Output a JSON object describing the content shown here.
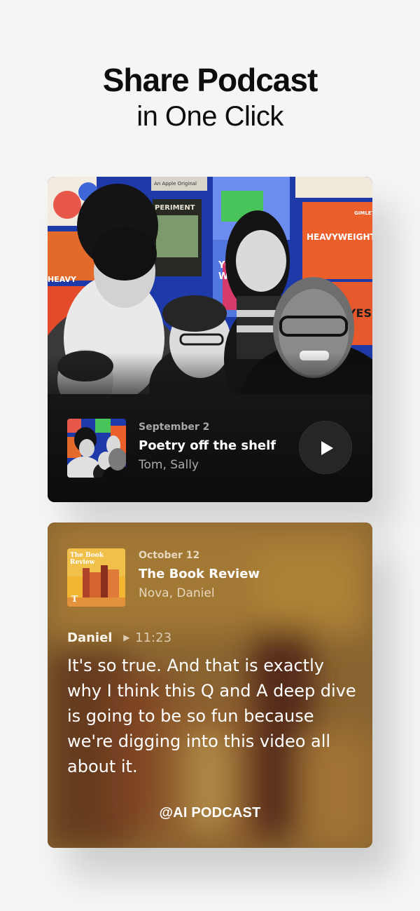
{
  "headline": {
    "title": "Share Podcast",
    "subtitle": "in One Click"
  },
  "episode_card": {
    "artwork_texts": {
      "apple_original": "An Apple Original",
      "experiment": "PERIMENT",
      "heavyweight": "HEAVYWEIGHT",
      "gimlet": "GIMLET",
      "heavy_left": "HEAVY",
      "eyes": "EYES",
      "you": "YO",
      "wi": "WI"
    },
    "date": "September 2",
    "title": "Poetry off the shelf",
    "people": "Tom, Sally",
    "play_icon": "play-icon"
  },
  "quote_card": {
    "cover_text": "The Book Review",
    "date": "October 12",
    "title": "The Book Review",
    "people": "Nova, Daniel",
    "speaker": "Daniel",
    "timestamp": "11:23",
    "quote": "It's so true. And that is exactly why I think this Q and A deep dive is going to be so fun because we're digging into this video all about it.",
    "brand": "@AI PODCAST"
  },
  "colors": {
    "background": "#f5f5f5",
    "card_dark": "#111111",
    "card_warm": "#8d6a35",
    "accent_orange": "#e85a2a"
  }
}
